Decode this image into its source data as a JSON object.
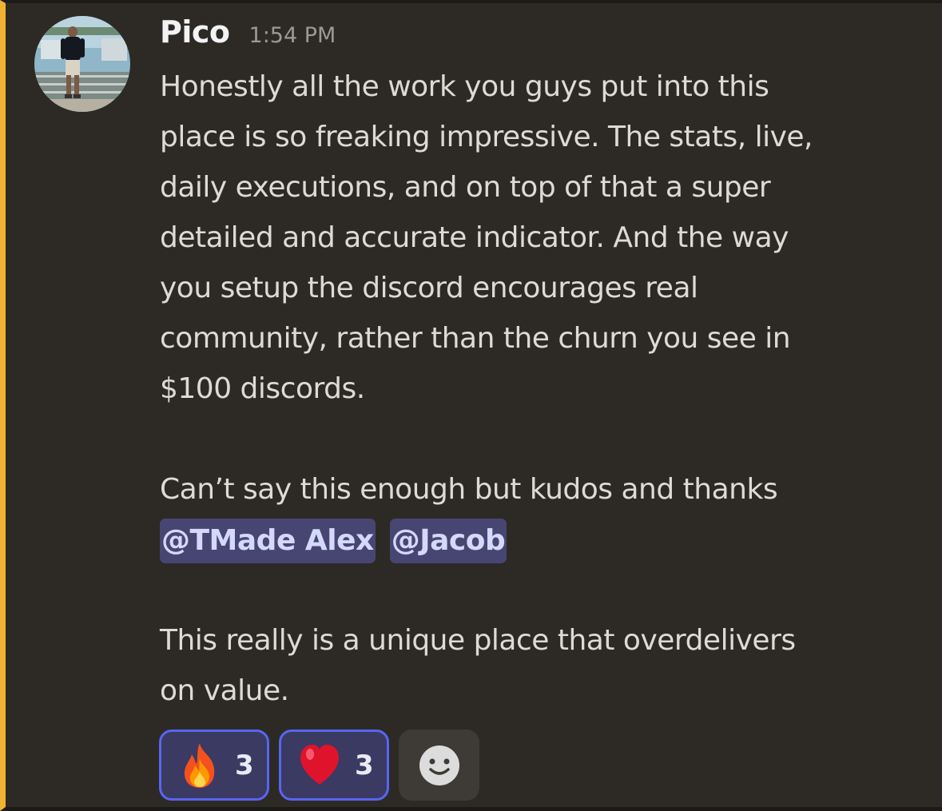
{
  "message": {
    "author": "Pico",
    "timestamp": "1:54 PM",
    "paragraph1_lines": [
      "Honestly all the work you guys put into this",
      "place is so freaking impressive. The stats, live,",
      "daily executions, and on top of that a super",
      "detailed and accurate indicator. And the way",
      "you setup the discord encourages real",
      "community, rather than the churn you see in",
      "$100 discords."
    ],
    "paragraph2": "Can’t say this enough but kudos and thanks",
    "mentions": [
      "@TMade Alex",
      "@Jacob"
    ],
    "paragraph3_lines": [
      "This really is a unique place that overdelivers",
      "on value."
    ]
  },
  "reactions": [
    {
      "emoji": "fire-emoji",
      "count": "3"
    },
    {
      "emoji": "red-heart-emoji",
      "count": "3"
    }
  ],
  "colors": {
    "accent_bar": "#f0b232",
    "background": "#2d2a25",
    "mention_bg": "#474673",
    "mention_text": "#d4d8fb",
    "reaction_border": "#5865f2",
    "reaction_bg": "#3a3a63"
  },
  "icons": {
    "add_reaction": "smiley-face-icon"
  }
}
